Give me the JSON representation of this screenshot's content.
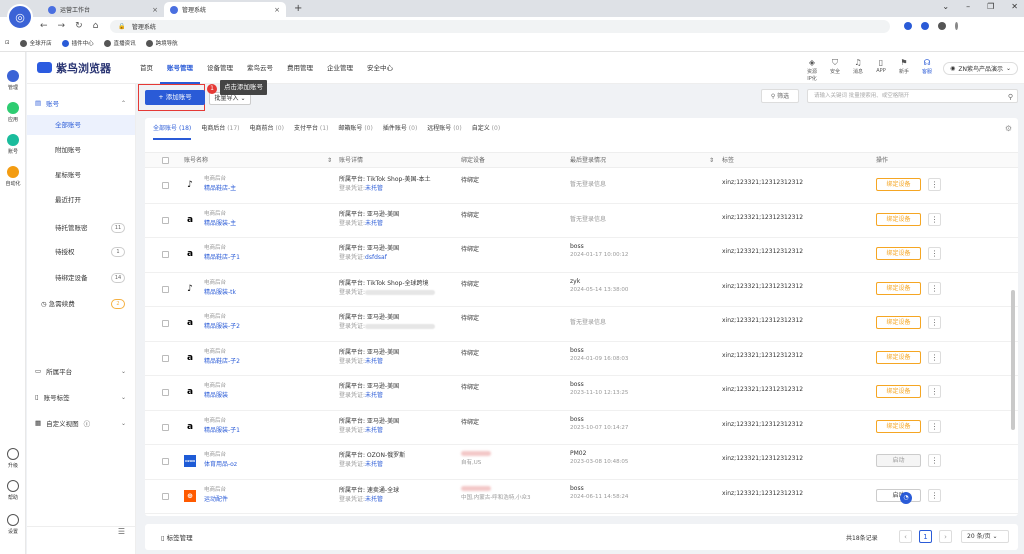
{
  "browser": {
    "tabs": [
      {
        "label": "运营工作台"
      },
      {
        "label": "管理系统"
      }
    ],
    "url": "管理系统",
    "bookmarks": [
      "全球开店",
      "插件中心",
      "直播资讯",
      "跨境导航"
    ]
  },
  "rail": {
    "items": [
      "管理",
      "应用",
      "账号",
      "自动化"
    ],
    "bottom": [
      "升级",
      "帮助",
      "设置"
    ]
  },
  "app": {
    "brand": "紫鸟浏览器",
    "nav": [
      "首页",
      "账号管理",
      "设备管理",
      "紫鸟云号",
      "费用管理",
      "企业管理",
      "安全中心"
    ],
    "nav_active": "账号管理",
    "header_icons": [
      "资源IP化",
      "安全",
      "消息",
      "APP",
      "新手",
      "客服"
    ],
    "user": "ZN紫鸟产品演示"
  },
  "sidebar": {
    "section_title": "账号",
    "items": [
      {
        "label": "全部账号",
        "count": ""
      },
      {
        "label": "附加账号",
        "count": ""
      },
      {
        "label": "星标账号",
        "count": ""
      },
      {
        "label": "最近打开",
        "count": ""
      },
      {
        "label": "待托管账密",
        "count": "11"
      },
      {
        "label": "待授权",
        "count": "1"
      },
      {
        "label": "待绑定设备",
        "count": "14"
      }
    ],
    "renew": {
      "label": "急需续费",
      "count": "2"
    },
    "groups": [
      "所属平台",
      "账号标签",
      "自定义视图"
    ]
  },
  "toolbar": {
    "add_label": "+ 添加账号",
    "badge": "1",
    "tooltip": "点击添加账号",
    "batch_label": "批量导入",
    "filter_label": "筛选",
    "search_placeholder": "请输入关键词 批量搜索用、或空格隔开"
  },
  "tabs": [
    {
      "label": "全部账号",
      "count": "(18)"
    },
    {
      "label": "电商后台",
      "count": "(17)"
    },
    {
      "label": "电商前台",
      "count": "(0)"
    },
    {
      "label": "支付平台",
      "count": "(1)"
    },
    {
      "label": "邮箱账号",
      "count": "(0)"
    },
    {
      "label": "插件账号",
      "count": "(0)"
    },
    {
      "label": "远程账号",
      "count": "(0)"
    },
    {
      "label": "自定义",
      "count": "(0)"
    }
  ],
  "columns": [
    "账号名称",
    "账号详情",
    "绑定设备",
    "最后登录情况",
    "标签",
    "操作"
  ],
  "rows": [
    {
      "logo": "tiktok",
      "type": "电商后台",
      "name": "精品鞋店-主",
      "platform": "所属平台: TikTok Shop-美国-本土",
      "cred_label": "登录凭证:",
      "cred": "未托管",
      "device": "待绑定",
      "device2": "",
      "login1": "",
      "login2": "",
      "login_single": "暂无登录信息",
      "tag": "xinz;123321;12312312312",
      "op": "绑定设备",
      "op_style": "orange"
    },
    {
      "logo": "amazon",
      "type": "电商后台",
      "name": "精品服装-主",
      "platform": "所属平台: 亚马逊-美国",
      "cred_label": "登录凭证:",
      "cred": "未托管",
      "device": "待绑定",
      "device2": "",
      "login1": "",
      "login2": "",
      "login_single": "暂无登录信息",
      "tag": "xinz;123321;12312312312",
      "op": "绑定设备",
      "op_style": "orange"
    },
    {
      "logo": "amazon",
      "type": "电商后台",
      "name": "精品鞋店-子1",
      "platform": "所属平台: 亚马逊-美国",
      "cred_label": "登录凭证:",
      "cred": "dsfdsaf",
      "device": "待绑定",
      "device2": "",
      "login1": "boss",
      "login2": "2024-01-17 10:00:12",
      "login_single": "",
      "tag": "xinz;123321;12312312312",
      "op": "绑定设备",
      "op_style": "orange"
    },
    {
      "logo": "tiktok",
      "type": "电商后台",
      "name": "精品服装-tk",
      "platform": "所属平台: TikTok Shop-全球跨境",
      "cred_label": "登录凭证:",
      "cred": "",
      "device": "待绑定",
      "device2": "",
      "login1": "zyk",
      "login2": "2024-05-14 13:38:00",
      "login_single": "",
      "tag": "xinz;123321;12312312312",
      "op": "绑定设备",
      "op_style": "orange"
    },
    {
      "logo": "amazon",
      "type": "电商后台",
      "name": "精品服装-子2",
      "platform": "所属平台: 亚马逊-美国",
      "cred_label": "登录凭证:",
      "cred": "",
      "device": "待绑定",
      "device2": "",
      "login1": "",
      "login2": "",
      "login_single": "暂无登录信息",
      "tag": "xinz;123321;12312312312",
      "op": "绑定设备",
      "op_style": "orange"
    },
    {
      "logo": "amazon",
      "type": "电商后台",
      "name": "精品鞋店-子2",
      "platform": "所属平台: 亚马逊-美国",
      "cred_label": "登录凭证:",
      "cred": "未托管",
      "device": "待绑定",
      "device2": "",
      "login1": "boss",
      "login2": "2024-01-09 16:08:03",
      "login_single": "",
      "tag": "xinz;123321;12312312312",
      "op": "绑定设备",
      "op_style": "orange"
    },
    {
      "logo": "amazon",
      "type": "电商后台",
      "name": "精品服装",
      "platform": "所属平台: 亚马逊-美国",
      "cred_label": "登录凭证:",
      "cred": "未托管",
      "device": "待绑定",
      "device2": "",
      "login1": "boss",
      "login2": "2023-11-10 12:13:25",
      "login_single": "",
      "tag": "xinz;123321;12312312312",
      "op": "绑定设备",
      "op_style": "orange"
    },
    {
      "logo": "amazon",
      "type": "电商后台",
      "name": "精品服装-子1",
      "platform": "所属平台: 亚马逊-美国",
      "cred_label": "登录凭证:",
      "cred": "未托管",
      "device": "待绑定",
      "device2": "",
      "login1": "boss",
      "login2": "2023-10-07 10:14:27",
      "login_single": "",
      "tag": "xinz;123321;12312312312",
      "op": "绑定设备",
      "op_style": "orange"
    },
    {
      "logo": "ozon",
      "type": "电商后台",
      "name": "体育用品-oz",
      "platform": "所属平台: OZON-俄罗斯",
      "cred_label": "登录凭证:",
      "cred": "未托管",
      "device": "",
      "device2": "自有,US",
      "login1": "PM02",
      "login2": "2023-03-08 10:48:05",
      "login_single": "",
      "tag": "xinz;123321;12312312312",
      "op": "启动",
      "op_style": "gray"
    },
    {
      "logo": "ali",
      "type": "电商后台",
      "name": "运动配件",
      "platform": "所属平台: 速卖通-全球",
      "cred_label": "登录凭证:",
      "cred": "未托管",
      "device": "",
      "device2": "中国,内蒙古-呼和浩特,小众3",
      "login1": "boss",
      "login2": "2024-06-11 14:58:24",
      "login_single": "",
      "tag": "xinz;123321;12312312312",
      "op": "启动",
      "op_style": "blue"
    }
  ],
  "footer": {
    "label_manage": "标签管理",
    "total": "共18条记录",
    "page": "1",
    "page_size": "20 条/页"
  }
}
